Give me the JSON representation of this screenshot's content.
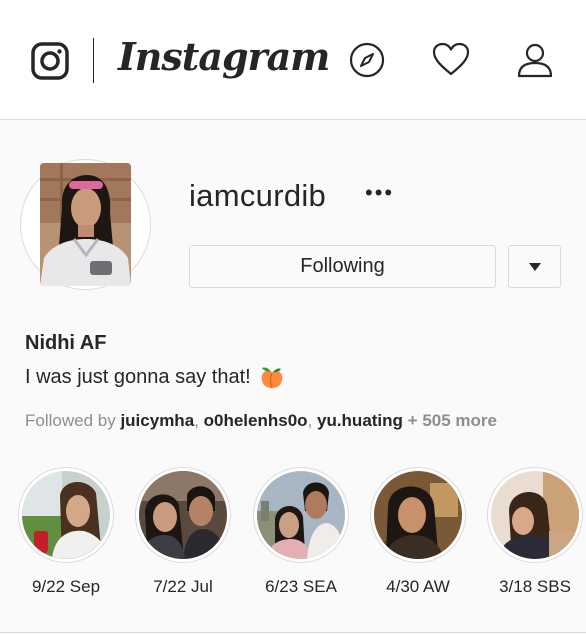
{
  "header": {
    "logo_text": "Instagram",
    "icons": [
      "instagram-glyph-icon",
      "compass-icon",
      "heart-icon",
      "user-icon"
    ]
  },
  "profile": {
    "username": "iamcurdib",
    "more_label": "•••",
    "follow_button_label": "Following",
    "full_name": "Nidhi AF",
    "bio": "I was just gonna say that!",
    "bio_emoji": "peach-emoji",
    "followed_by": {
      "prefix": "Followed by",
      "accounts": [
        "juicymha",
        "o0helenhs0o",
        "yu.huating"
      ],
      "more": "+ 505 more"
    }
  },
  "highlights": [
    {
      "label": "9/22 Sep"
    },
    {
      "label": "7/22 Jul"
    },
    {
      "label": "6/23 SEA"
    },
    {
      "label": "4/30 AW"
    },
    {
      "label": "3/18 SBS"
    }
  ],
  "colors": {
    "text": "#262626",
    "secondary_text": "#8e8e8e",
    "border": "#dbdbdb",
    "background": "#fafafa"
  }
}
